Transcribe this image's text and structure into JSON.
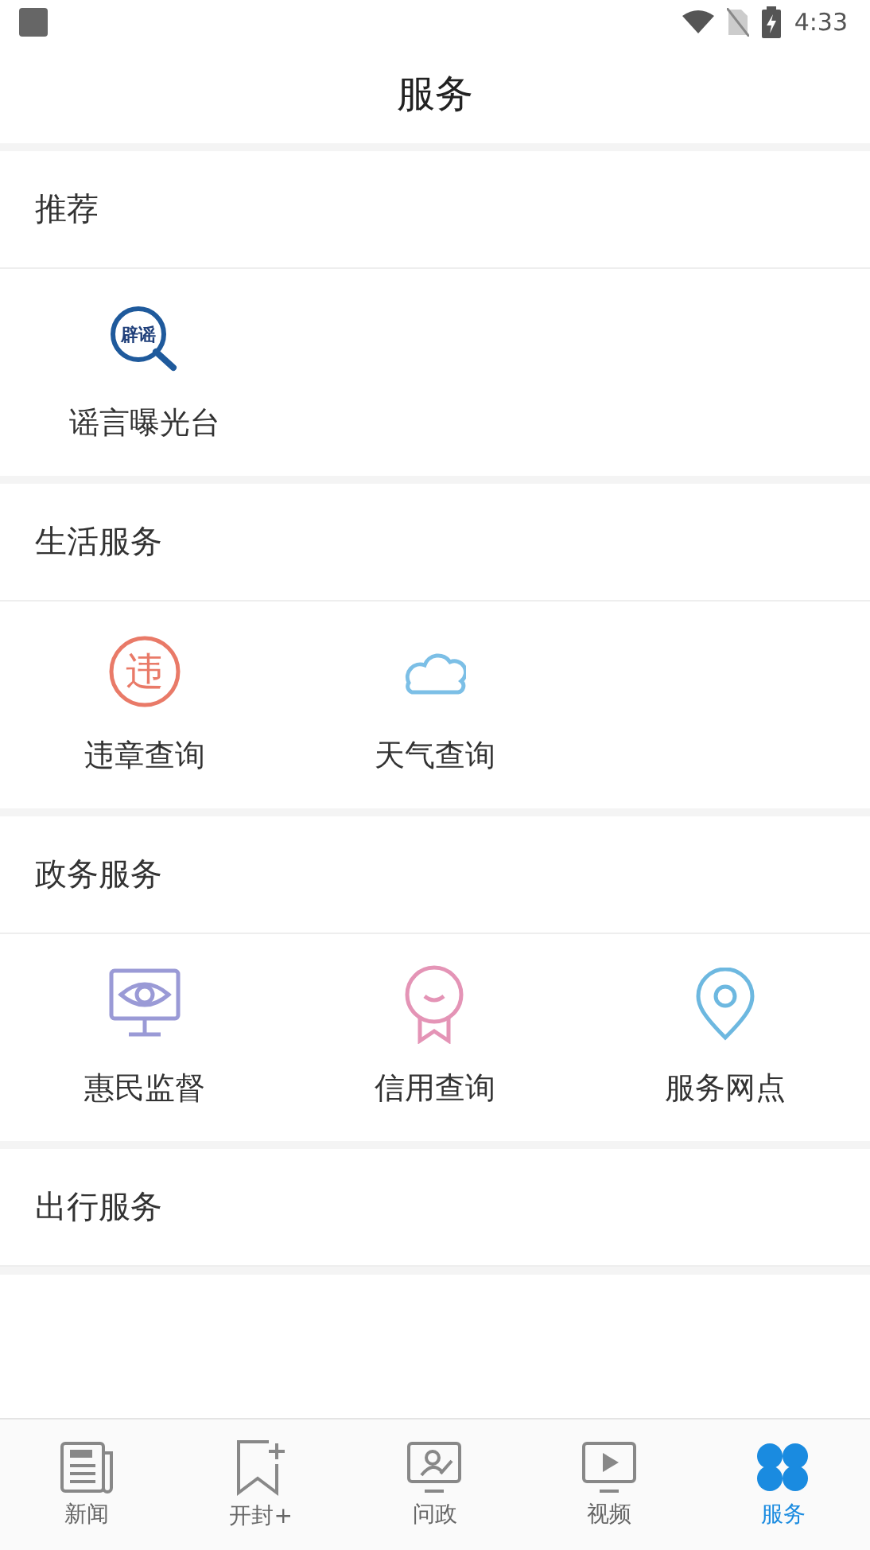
{
  "status_bar": {
    "time": "4:33"
  },
  "header": {
    "title": "服务"
  },
  "sections": [
    {
      "title": "推荐",
      "items": [
        {
          "label": "谣言曝光台",
          "kind": "rumor",
          "icon_text": "辟谣"
        }
      ]
    },
    {
      "title": "生活服务",
      "items": [
        {
          "label": "违章查询",
          "kind": "violation",
          "icon_text": "违"
        },
        {
          "label": "天气查询",
          "kind": "weather"
        }
      ]
    },
    {
      "title": "政务服务",
      "items": [
        {
          "label": "惠民监督",
          "kind": "monitor"
        },
        {
          "label": "信用查询",
          "kind": "medal"
        },
        {
          "label": "服务网点",
          "kind": "pin"
        }
      ]
    },
    {
      "title": "出行服务"
    }
  ],
  "tabs": [
    {
      "label": "新闻",
      "kind": "news",
      "selected": false
    },
    {
      "label": "开封+",
      "kind": "bookmark",
      "selected": false
    },
    {
      "label": "问政",
      "kind": "ask",
      "selected": false
    },
    {
      "label": "视频",
      "kind": "video",
      "selected": false
    },
    {
      "label": "服务",
      "kind": "service",
      "selected": true
    }
  ]
}
